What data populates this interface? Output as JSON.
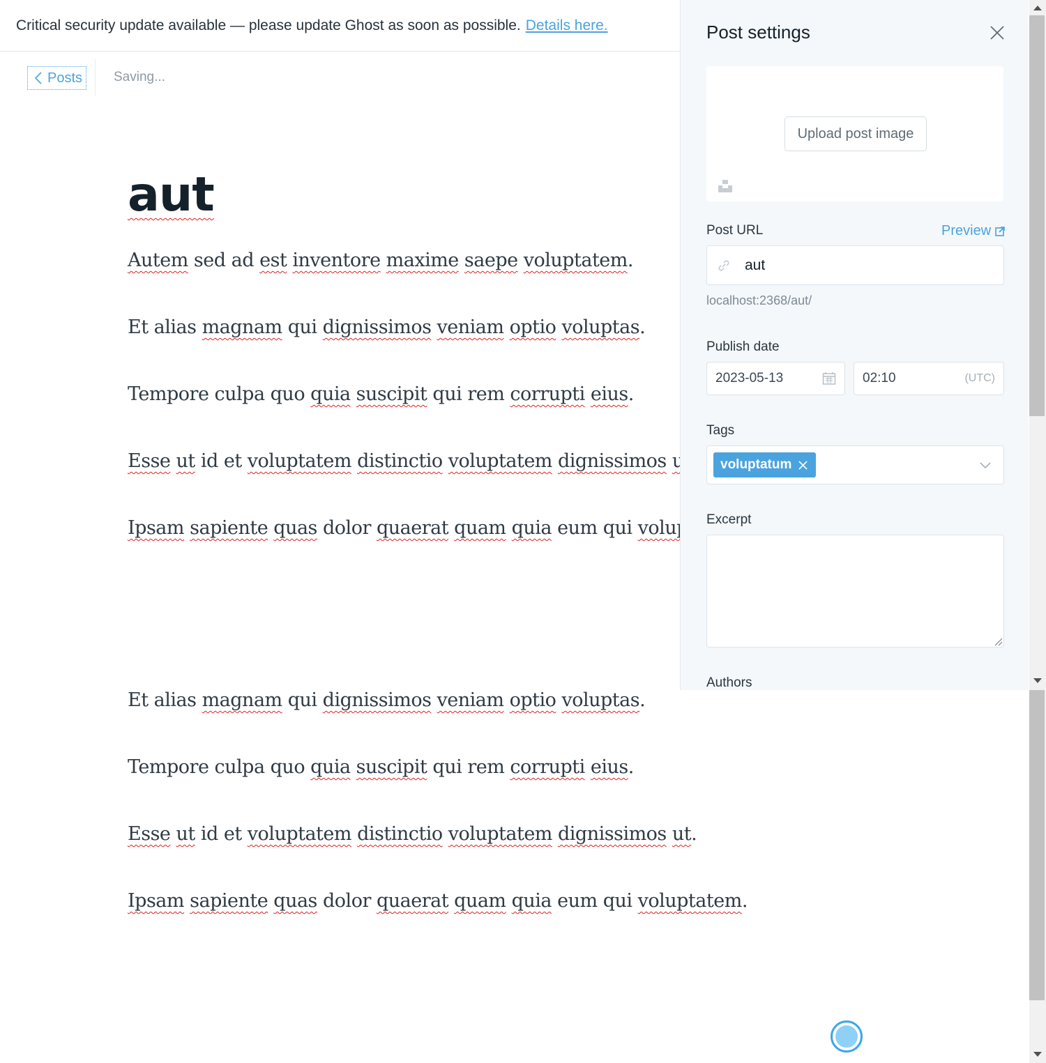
{
  "banner": {
    "message": "Critical security update available — please update Ghost as soon as possible.",
    "link": "Details here."
  },
  "topbar": {
    "back_label": "Posts",
    "status": "Saving..."
  },
  "post": {
    "title": "aut",
    "paragraphs_top": [
      "Autem sed ad est inventore maxime saepe voluptatem.",
      "Et alias magnam qui dignissimos veniam optio voluptas.",
      "Tempore culpa quo quia suscipit qui rem corrupti eius.",
      "Esse ut id et voluptatem distinctio voluptatem dignissimos ut.",
      "Ipsam sapiente quas dolor quaerat quam quia eum qui voluptatem."
    ],
    "paragraphs_bottom": [
      "Et alias magnam qui dignissimos veniam optio voluptas.",
      "Tempore culpa quo quia suscipit qui rem corrupti eius.",
      "Esse ut id et voluptatem distinctio voluptatem dignissimos ut.",
      "Ipsam sapiente quas dolor quaerat quam quia eum qui voluptatem."
    ]
  },
  "settings": {
    "title": "Post settings",
    "upload_label": "Upload post image",
    "post_url_label": "Post URL",
    "preview_label": "Preview",
    "slug": "aut",
    "url_hint": "localhost:2368/aut/",
    "publish_date_label": "Publish date",
    "date": "2023-05-13",
    "time": "02:10",
    "timezone": "(UTC)",
    "tags_label": "Tags",
    "tag": "voluptatum",
    "excerpt_label": "Excerpt",
    "excerpt_value": "",
    "authors_label": "Authors"
  },
  "colors": {
    "accent": "#4aa3df",
    "panel_bg": "#f4f8fb"
  }
}
